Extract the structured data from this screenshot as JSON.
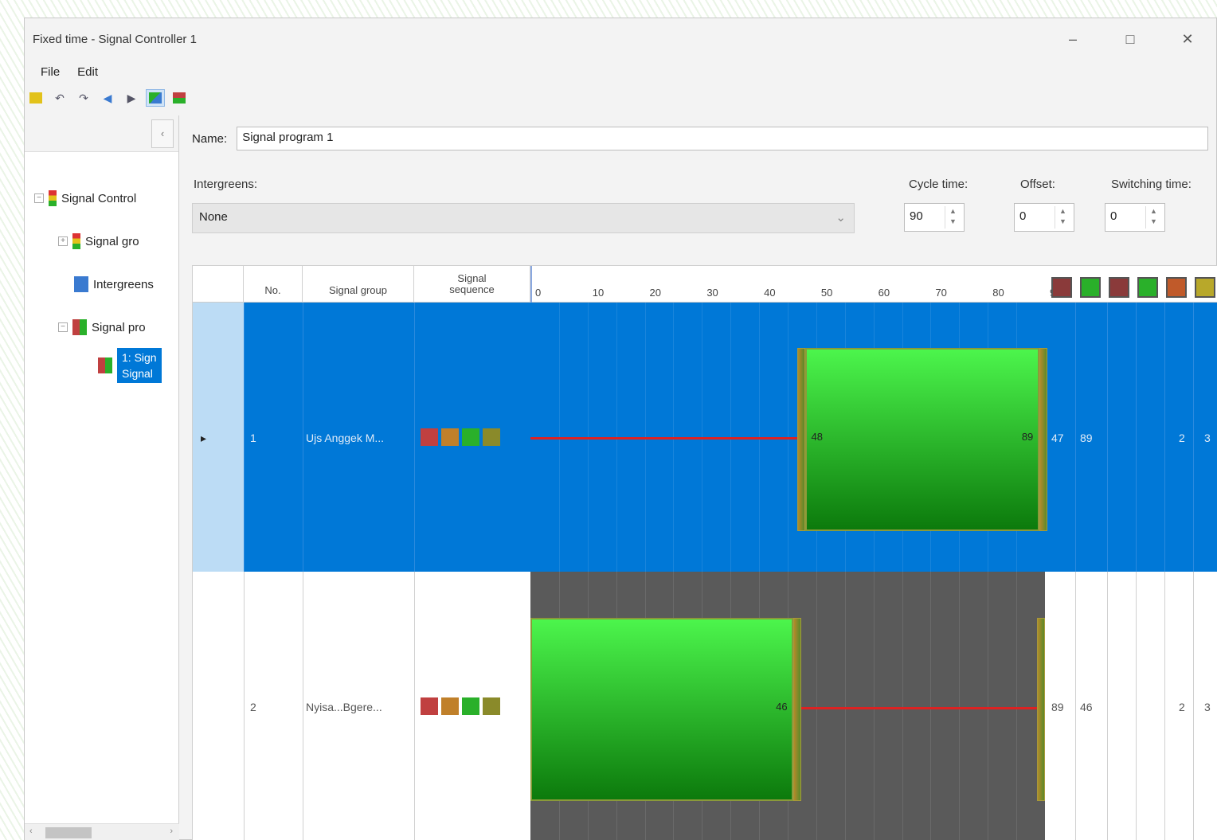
{
  "window": {
    "title": "Fixed time - Signal Controller 1",
    "minimize": "–",
    "maximize": "□",
    "close": "✕"
  },
  "menu": {
    "file": "File",
    "edit": "Edit"
  },
  "toolbar": {
    "icons": [
      "new-signal-icon",
      "undo-icon",
      "redo-icon",
      "move-left-icon",
      "move-right-icon",
      "view-icon-1",
      "view-icon-2"
    ]
  },
  "tree": {
    "collapse": "‹",
    "items": [
      {
        "label": "Signal Control",
        "icon": "traffic-light-icon"
      },
      {
        "label": "Signal gro",
        "icon": "signal-group-icon"
      },
      {
        "label": "Intergreens",
        "icon": "intergreen-icon"
      },
      {
        "label": "Signal pro",
        "icon": "signal-program-icon"
      },
      {
        "label": "1: Sign",
        "label2": "Signal",
        "icon": "program-item-icon"
      }
    ]
  },
  "program": {
    "name_label": "Name:",
    "name_value": "Signal program 1",
    "intergreens_label": "Intergreens:",
    "intergreens_value": "None",
    "cycle_label": "Cycle time:",
    "cycle_value": "90",
    "offset_label": "Offset:",
    "offset_value": "0",
    "switching_label": "Switching time:",
    "switching_value": "0"
  },
  "grid": {
    "headers": {
      "no": "No.",
      "group": "Signal group",
      "sequence_1": "Signal",
      "sequence_2": "sequence"
    },
    "ticks": [
      "0",
      "10",
      "20",
      "30",
      "40",
      "50",
      "60",
      "70",
      "80",
      "9"
    ],
    "header_squares": [
      "#8a3a3a",
      "#2ab02a",
      "#8a3a3a",
      "#2ab02a",
      "#c05a2a",
      "#b8a82a"
    ],
    "rows": [
      {
        "marker": "▸",
        "no": "1",
        "group": "Ujs Anggek M...",
        "green_start": 48,
        "green_end": 89,
        "green_start_label": "48",
        "green_end_label": "89",
        "c1": "47",
        "c2": "89",
        "c3": "2",
        "c4": "3"
      },
      {
        "marker": "",
        "no": "2",
        "group": "Nyisa...Bgere...",
        "green_start": 0,
        "green_end": 46,
        "green_start_label": "",
        "green_end_label": "46",
        "c1": "89",
        "c2": "46",
        "c3": "2",
        "c4": "3"
      }
    ]
  }
}
